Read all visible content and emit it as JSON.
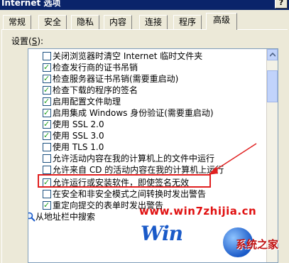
{
  "window": {
    "title": "Internet 选项",
    "help_button": "?"
  },
  "tabs": [
    {
      "label": "常规"
    },
    {
      "label": "安全"
    },
    {
      "label": "隐私"
    },
    {
      "label": "内容"
    },
    {
      "label": "连接"
    },
    {
      "label": "程序"
    },
    {
      "label": "高级",
      "active": true
    }
  ],
  "settings": {
    "label_text": "设置(",
    "label_hotkey": "S",
    "label_end": "):",
    "items": [
      {
        "label": "关闭浏览器时清空 Internet 临时文件夹",
        "checked": false
      },
      {
        "label": "检查发行商的证书吊销",
        "checked": true
      },
      {
        "label": "检查服务器证书吊销(需要重启动)",
        "checked": true
      },
      {
        "label": "检查下载的程序的签名",
        "checked": true
      },
      {
        "label": "启用配置文件助理",
        "checked": true
      },
      {
        "label": "启用集成 Windows 身份验证(需要重启动)",
        "checked": true
      },
      {
        "label": "使用 SSL 2.0",
        "checked": true
      },
      {
        "label": "使用 SSL 3.0",
        "checked": true
      },
      {
        "label": "使用 TLS 1.0",
        "checked": false
      },
      {
        "label": "允许活动内容在我的计算机上的文件中运行",
        "checked": false
      },
      {
        "label": "允许来自 CD 的活动内容在我的计算机上运行",
        "checked": false
      },
      {
        "label": "允许运行或安装软件，即使签名无效",
        "checked": true
      },
      {
        "label": "在安全和非安全模式之间转换时发出警告",
        "checked": false
      },
      {
        "label": "重定向提交的表单时发出警告",
        "checked": true
      },
      {
        "label": "从地址栏中搜索",
        "icon": "search-icon"
      }
    ]
  },
  "watermark": {
    "site": "www.win7zhijia.cn",
    "logo_letters": "Win",
    "logo_name": "系统之家"
  },
  "colors": {
    "title_bar": "#0a246a",
    "dialog_bg": "#ece9d8",
    "check_mark": "#21a121",
    "highlight": "#e02020",
    "watermark_red": "#e01010",
    "logo_blue": "#1a5ac8"
  }
}
